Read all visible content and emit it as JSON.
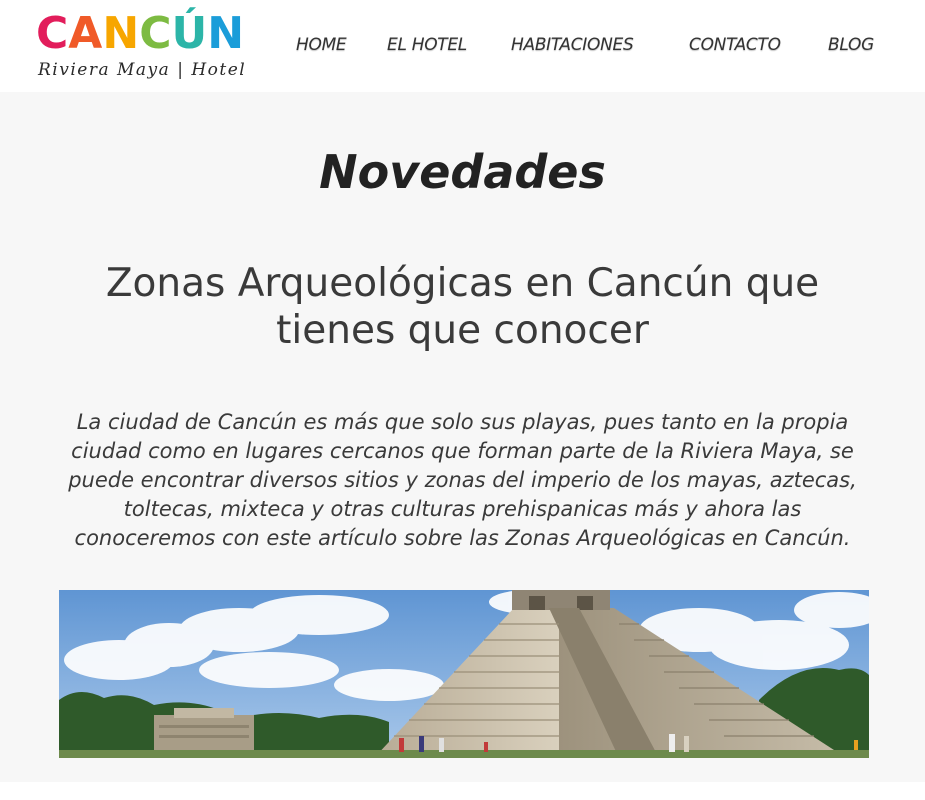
{
  "brand": {
    "logo_letters": [
      {
        "char": "C",
        "color": "#e21d5b"
      },
      {
        "char": "A",
        "color": "#f05a28"
      },
      {
        "char": "N",
        "color": "#f7a600"
      },
      {
        "char": "C",
        "color": "#7dbb42"
      },
      {
        "char": "Ú",
        "color": "#2cb5a8"
      },
      {
        "char": "N",
        "color": "#1b9dd9"
      }
    ],
    "tagline": "Riviera Maya | Hotel"
  },
  "nav": {
    "items": [
      {
        "label": "HOME"
      },
      {
        "label": "EL HOTEL"
      },
      {
        "label": "HABITACIONES"
      },
      {
        "label": "CONTACTO"
      },
      {
        "label": "BLOG"
      }
    ]
  },
  "main": {
    "section_title": "Novedades",
    "post": {
      "title": "Zonas Arqueológicas en Cancún que tienes que conocer",
      "excerpt": "La ciudad de Cancún es más que solo sus playas, pues tanto en la propia ciudad como en lugares cercanos que forman parte de la Riviera Maya, se puede encontrar diversos sitios y zonas del imperio de los mayas, aztecas, toltecas, mixteca y otras culturas prehispanicas más y ahora las conoceremos con este artículo sobre las Zonas Arqueológicas en Cancún."
    }
  },
  "colors": {
    "page_bg": "#f7f7f7",
    "text": "#3a3a3a",
    "nav_text": "#333333"
  }
}
